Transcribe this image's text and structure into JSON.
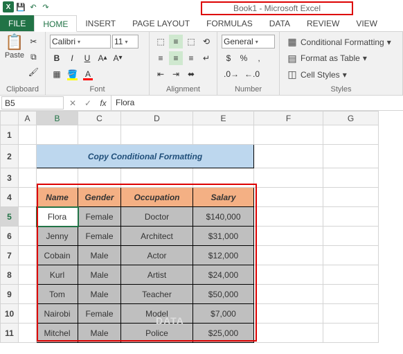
{
  "title": "Book1 - Microsoft Excel",
  "tabs": {
    "file": "FILE",
    "home": "HOME",
    "insert": "INSERT",
    "pagelayout": "PAGE LAYOUT",
    "formulas": "FORMULAS",
    "data": "DATA",
    "review": "REVIEW",
    "view": "VIEW"
  },
  "ribbon": {
    "clipboard": {
      "paste": "Paste",
      "label": "Clipboard"
    },
    "font": {
      "name": "Calibri",
      "size": "11",
      "label": "Font"
    },
    "alignment": {
      "label": "Alignment"
    },
    "number": {
      "format": "General",
      "label": "Number"
    },
    "styles": {
      "cond": "Conditional Formatting",
      "table": "Format as Table",
      "cell": "Cell Styles",
      "label": "Styles"
    }
  },
  "namebox": "B5",
  "formula": "Flora",
  "cols": [
    "A",
    "B",
    "C",
    "D",
    "E",
    "F",
    "G"
  ],
  "rows": [
    "1",
    "2",
    "3",
    "4",
    "5",
    "6",
    "7",
    "8",
    "9",
    "10",
    "11"
  ],
  "titlecell": "Copy Conditional Formatting",
  "headers": {
    "name": "Name",
    "gender": "Gender",
    "occupation": "Occupation",
    "salary": "Salary"
  },
  "data": [
    {
      "name": "Flora",
      "gender": "Female",
      "occ": "Doctor",
      "sal": "$140,000"
    },
    {
      "name": "Jenny",
      "gender": "Female",
      "occ": "Architect",
      "sal": "$31,000"
    },
    {
      "name": "Cobain",
      "gender": "Male",
      "occ": "Actor",
      "sal": "$12,000"
    },
    {
      "name": "Kurl",
      "gender": "Male",
      "occ": "Artist",
      "sal": "$24,000"
    },
    {
      "name": "Tom",
      "gender": "Male",
      "occ": "Teacher",
      "sal": "$50,000"
    },
    {
      "name": "Nairobi",
      "gender": "Female",
      "occ": "Model",
      "sal": "$7,000"
    },
    {
      "name": "Mitchel",
      "gender": "Male",
      "occ": "Police",
      "sal": "$25,000"
    }
  ],
  "watermark": "DATA"
}
